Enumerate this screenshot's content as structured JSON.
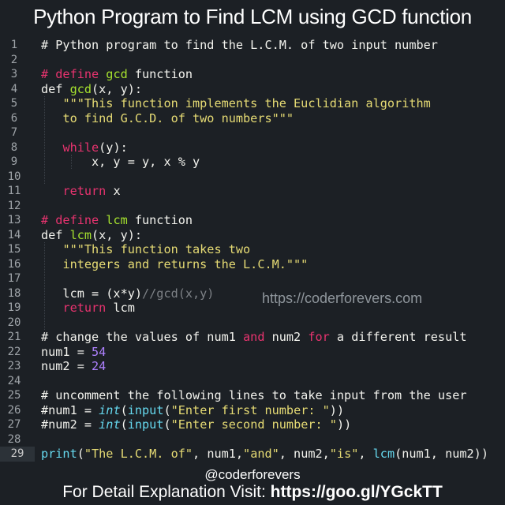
{
  "title": "Python Program to Find LCM using GCD function",
  "watermark": "https://coderforevers.com",
  "handle": "@coderforevers",
  "footer": {
    "text": "For Detail Explanation Visit: ",
    "link": "https://goo.gl/YGckTT"
  },
  "active_line": 29,
  "colors": {
    "background": "#1c2025",
    "keyword": "#e8336f",
    "function": "#a6e22e",
    "string": "#e6db74",
    "number": "#ae81ff",
    "builtin": "#66d9ef",
    "comment": "#7d8186"
  },
  "code_lines": [
    [
      [
        "# Python program to find the L.C.M. of two input number",
        "pl"
      ]
    ],
    [],
    [
      [
        "# define ",
        "kw"
      ],
      [
        "gcd",
        "fn"
      ],
      [
        " function",
        "pl"
      ]
    ],
    [
      [
        "def ",
        "pl"
      ],
      [
        "gcd",
        "fn"
      ],
      [
        "(x, y):",
        "pl"
      ]
    ],
    [
      [
        "   ",
        "pl"
      ],
      [
        "\"\"\"This function implements the Euclidian algorithm",
        "str"
      ]
    ],
    [
      [
        "   ",
        "pl"
      ],
      [
        "to find G.C.D. of two numbers\"\"\"",
        "str"
      ]
    ],
    [],
    [
      [
        "   ",
        "pl"
      ],
      [
        "while",
        "kw"
      ],
      [
        "(y):",
        "pl"
      ]
    ],
    [
      [
        "       x, y = y, x % y",
        "pl"
      ]
    ],
    [],
    [
      [
        "   ",
        "pl"
      ],
      [
        "return",
        "kw"
      ],
      [
        " x",
        "pl"
      ]
    ],
    [],
    [
      [
        "# define ",
        "kw"
      ],
      [
        "lcm",
        "fn"
      ],
      [
        " function",
        "pl"
      ]
    ],
    [
      [
        "def ",
        "pl"
      ],
      [
        "lcm",
        "fn"
      ],
      [
        "(x, y):",
        "pl"
      ]
    ],
    [
      [
        "   ",
        "pl"
      ],
      [
        "\"\"\"This function takes two",
        "str"
      ]
    ],
    [
      [
        "   ",
        "pl"
      ],
      [
        "integers and returns the L.C.M.\"\"\"",
        "str"
      ]
    ],
    [],
    [
      [
        "   lcm = (x*y)",
        "pl"
      ],
      [
        "//gcd(x,y)",
        "cm"
      ]
    ],
    [
      [
        "   ",
        "pl"
      ],
      [
        "return",
        "kw"
      ],
      [
        " lcm",
        "pl"
      ]
    ],
    [],
    [
      [
        "# change the values of num1 ",
        "pl"
      ],
      [
        "and",
        "kw"
      ],
      [
        " num2 ",
        "pl"
      ],
      [
        "for",
        "kw"
      ],
      [
        " a different result",
        "pl"
      ]
    ],
    [
      [
        "num1 = ",
        "pl"
      ],
      [
        "54",
        "num"
      ]
    ],
    [
      [
        "num2 = ",
        "pl"
      ],
      [
        "24",
        "num"
      ]
    ],
    [],
    [
      [
        "# uncomment the following lines to take input from the user",
        "pl"
      ]
    ],
    [
      [
        "#num1 = ",
        "pl"
      ],
      [
        "int",
        "bi"
      ],
      [
        "(",
        "pl"
      ],
      [
        "input",
        "call"
      ],
      [
        "(",
        "pl"
      ],
      [
        "\"Enter first number: \"",
        "str"
      ],
      [
        "))",
        "pl"
      ]
    ],
    [
      [
        "#num2 = ",
        "pl"
      ],
      [
        "int",
        "bi"
      ],
      [
        "(",
        "pl"
      ],
      [
        "input",
        "call"
      ],
      [
        "(",
        "pl"
      ],
      [
        "\"Enter second number: \"",
        "str"
      ],
      [
        "))",
        "pl"
      ]
    ],
    [],
    [
      [
        "print",
        "call"
      ],
      [
        "(",
        "pl"
      ],
      [
        "\"The L.C.M. of\"",
        "str"
      ],
      [
        ", num1,",
        "pl"
      ],
      [
        "\"and\"",
        "str"
      ],
      [
        ", num2,",
        "pl"
      ],
      [
        "\"is\"",
        "str"
      ],
      [
        ", ",
        "pl"
      ],
      [
        "lcm",
        "call"
      ],
      [
        "(num1, num2))",
        "pl"
      ]
    ]
  ]
}
